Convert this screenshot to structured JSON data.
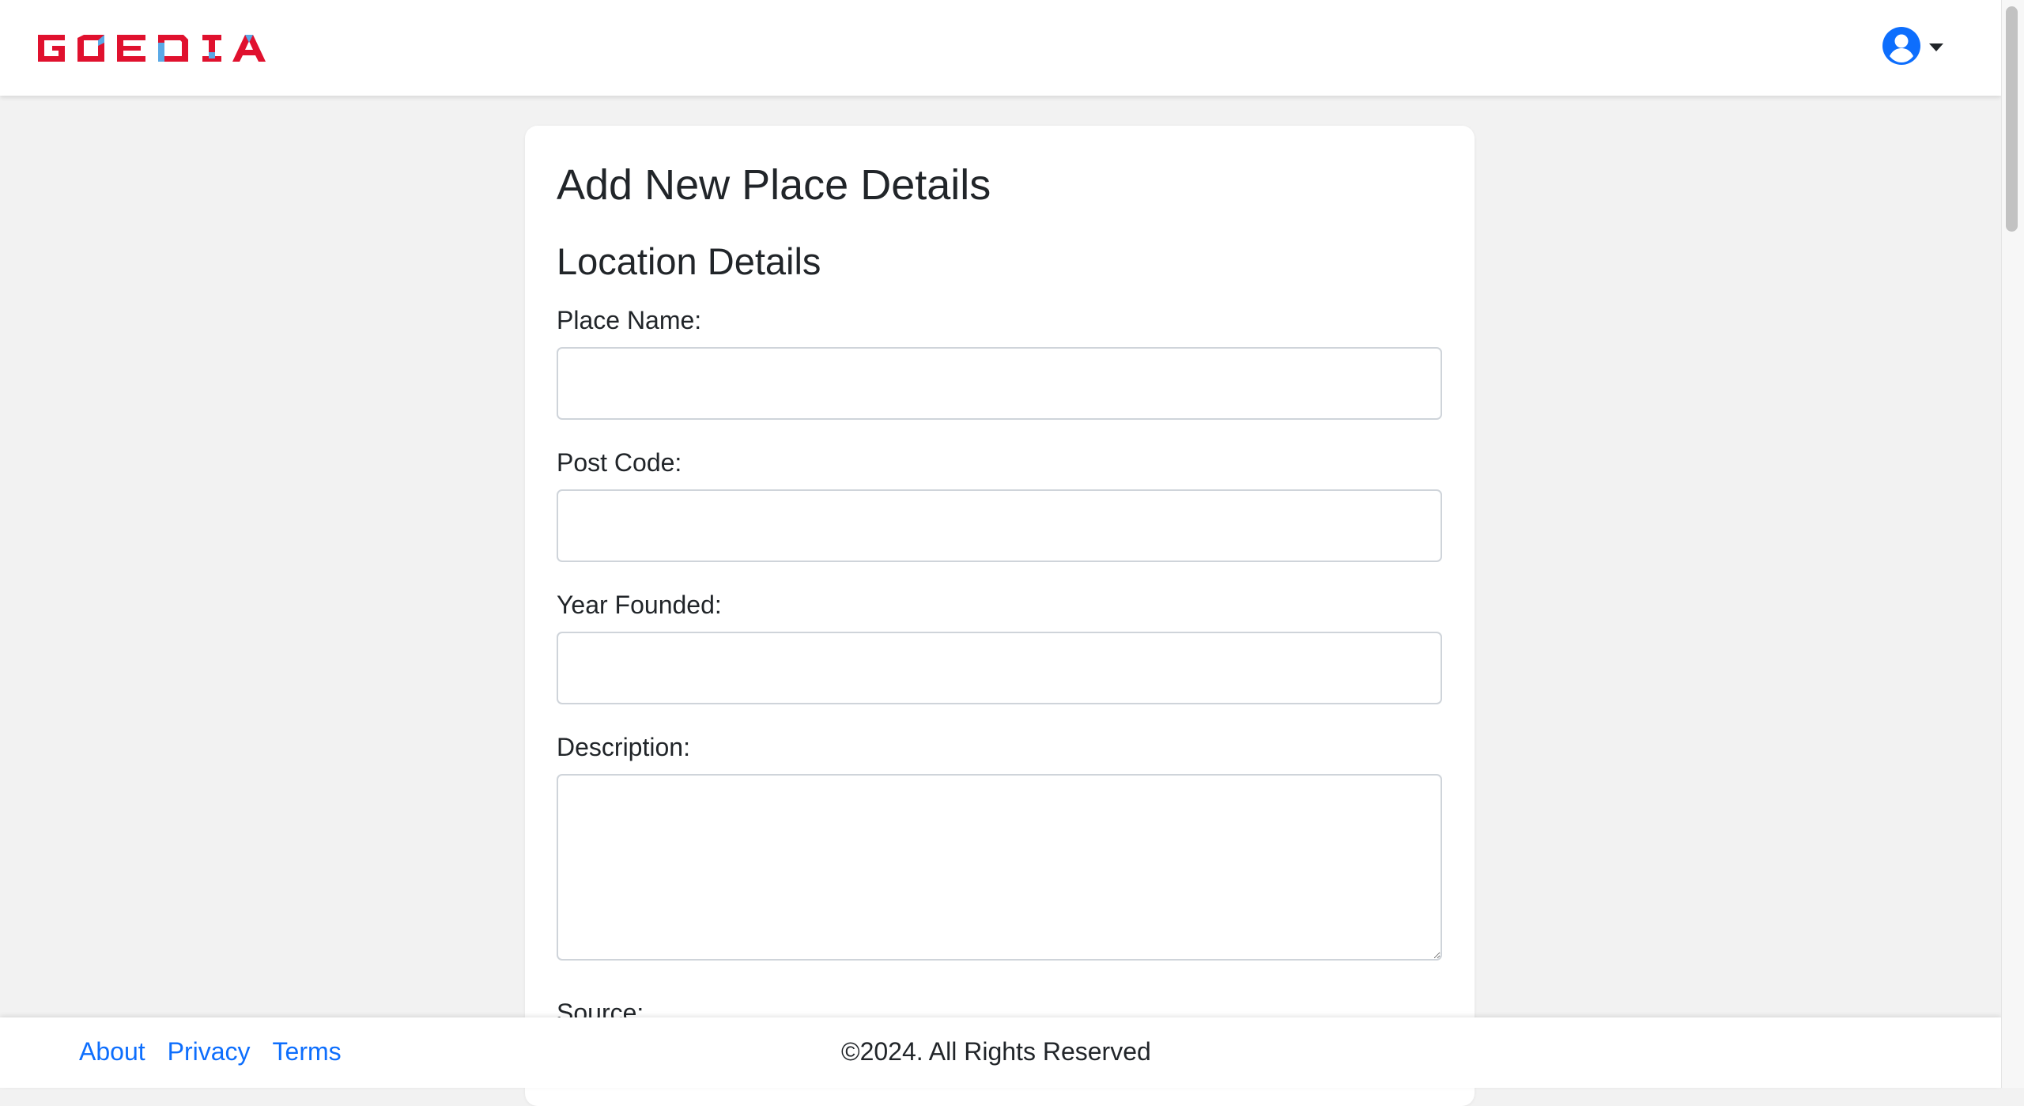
{
  "header": {
    "logo_text": "GOEDIA",
    "user_menu_icon": "user-circle-icon",
    "dropdown_icon": "caret-down-icon"
  },
  "form": {
    "title": "Add New Place Details",
    "section_title": "Location Details",
    "fields": [
      {
        "label": "Place Name:",
        "value": "",
        "placeholder": ""
      },
      {
        "label": "Post Code:",
        "value": "",
        "placeholder": ""
      },
      {
        "label": "Year Founded:",
        "value": "",
        "placeholder": ""
      },
      {
        "label": "Description:",
        "value": "",
        "placeholder": ""
      },
      {
        "label": "Source:"
      }
    ]
  },
  "footer": {
    "links": [
      "About",
      "Privacy",
      "Terms"
    ],
    "copyright": "©2024. All Rights Reserved"
  },
  "colors": {
    "brand_red": "#e0112e",
    "brand_blue": "#5aa9e6",
    "link_blue": "#0d6efd",
    "page_bg": "#f2f2f2"
  }
}
